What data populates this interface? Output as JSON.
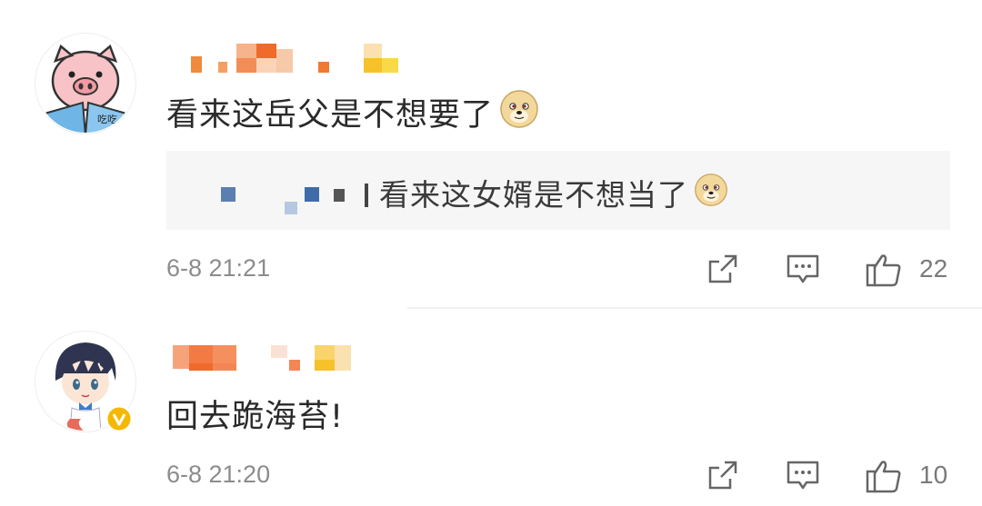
{
  "comments": [
    {
      "avatar": "pig-reading-avatar",
      "text": "看来这岳父是不想要了",
      "emoji": "doge-emoji",
      "reply": {
        "text": "看来这女婿是不想当了",
        "emoji": "doge-emoji"
      },
      "time": "6-8 21:21",
      "likes": "22"
    },
    {
      "avatar": "anime-boy-avatar",
      "verified": true,
      "text": "回去跪海苔!",
      "time": "6-8 21:20",
      "likes": "10"
    }
  ],
  "icons": {
    "share": "share-icon",
    "comment": "comment-icon",
    "like": "thumbs-up-icon"
  },
  "colors": {
    "verified_badge": "#f5b800",
    "text": "#2a2a2a",
    "meta": "#8c8c8c",
    "reply_bg": "#f6f6f6"
  }
}
